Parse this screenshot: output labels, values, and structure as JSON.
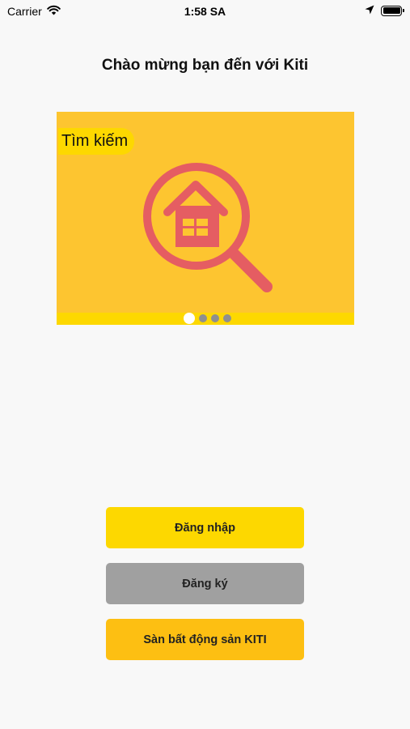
{
  "status_bar": {
    "carrier": "Carrier",
    "time": "1:58 SA"
  },
  "page": {
    "title": "Chào mừng bạn đến với Kiti"
  },
  "carousel": {
    "slide_label": "Tìm kiếm",
    "slide_icon": "house-search-icon",
    "page_count": 4,
    "active_page": 1,
    "colors": {
      "background": "#fdc530",
      "strip": "#fdd800",
      "icon": "#e55d62"
    }
  },
  "buttons": {
    "login": "Đăng nhập",
    "register": "Đăng ký",
    "market": "Sàn bất động sản KITI"
  },
  "colors": {
    "login_bg": "#fdd800",
    "register_bg": "#a0a0a0",
    "market_bg": "#fdbf12"
  }
}
